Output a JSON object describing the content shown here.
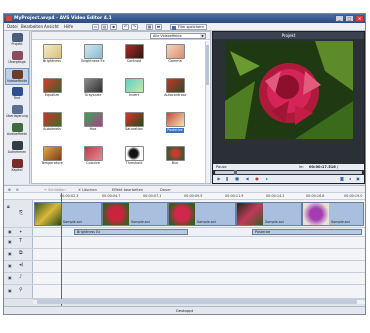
{
  "window": {
    "title": "MyProject.wvp4 - AVS Video Editor 4.1",
    "buttons": [
      "_",
      "□",
      "×"
    ]
  },
  "menu": {
    "items": [
      "Datei",
      "Bearbeiten",
      "Ansicht",
      "Hilfe"
    ],
    "save_label": "Film speichern"
  },
  "sidebar": {
    "items": [
      {
        "label": "Projekt",
        "icon": "film-icon"
      },
      {
        "label": "Übergänge",
        "icon": "transition-icon"
      },
      {
        "label": "Videoeffekte",
        "icon": "video-effects-icon"
      },
      {
        "label": "Text",
        "icon": "text-icon"
      },
      {
        "label": "Überlagerung",
        "icon": "overlay-icon"
      },
      {
        "label": "Audioeffekte",
        "icon": "audio-effects-icon"
      },
      {
        "label": "Aufnehmen",
        "icon": "record-icon"
      },
      {
        "label": "Kapitel",
        "icon": "chapter-icon"
      }
    ]
  },
  "browser": {
    "filter_value": "Alle Videoeffekte",
    "effects": [
      {
        "label": "Brightness"
      },
      {
        "label": "Brightness Ex"
      },
      {
        "label": "Contrast"
      },
      {
        "label": "Gamma"
      },
      {
        "label": "Equalize"
      },
      {
        "label": "Grayscale"
      },
      {
        "label": "Invert"
      },
      {
        "label": "Autocontrast"
      },
      {
        "label": "Autolevels"
      },
      {
        "label": "Hue"
      },
      {
        "label": "Saturation"
      },
      {
        "label": "Posterize"
      },
      {
        "label": "Temperature"
      },
      {
        "label": "Colorize"
      },
      {
        "label": "Threshold"
      },
      {
        "label": "Blur"
      }
    ],
    "selected_index": 11
  },
  "preview": {
    "title": "Projekt",
    "state": "Pause",
    "time_label": "Im",
    "time_value": "00:00:17.516 / 00:01:13.092",
    "position_fraction": 0.13
  },
  "timeline": {
    "toolbar": [
      "Schließen",
      "Löschen",
      "Effekt bearbeiten",
      "Dauer"
    ],
    "ruler": [
      "00:00:02.3",
      "00:00:04.7",
      "00:00:07.1",
      "00:00:09.5",
      "00:00:11.9",
      "00:00:14.2",
      "00:00:16.6",
      "00:00:19.0"
    ],
    "video_clips": [
      {
        "label": "Sample.avi"
      },
      {
        "label": "Sample.avi"
      },
      {
        "label": "Sample.avi"
      },
      {
        "label": "Sample.avi"
      },
      {
        "label": "Sample.avi"
      }
    ],
    "effect_clips": [
      {
        "label": "Brightness Ex"
      },
      {
        "label": "Posterize"
      }
    ],
    "status": "Gestoppt"
  }
}
